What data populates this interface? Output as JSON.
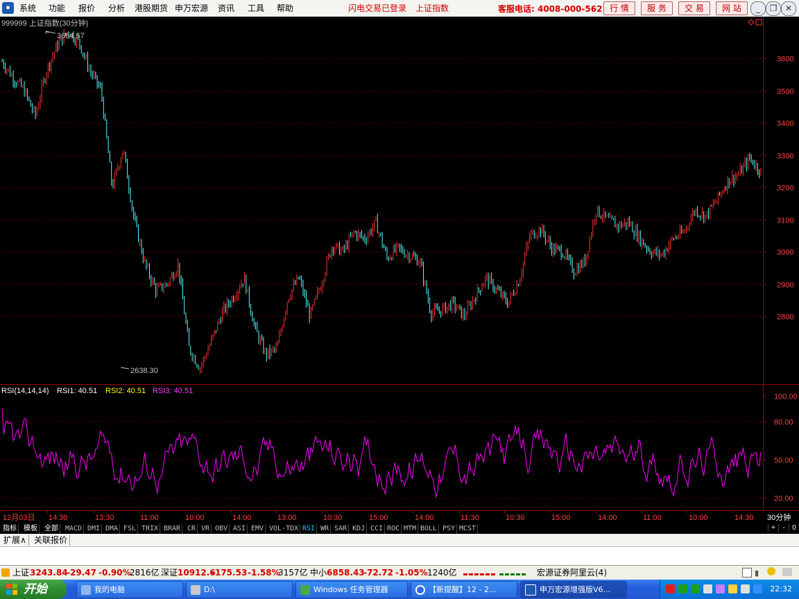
{
  "menu": {
    "items": [
      "系统",
      "功能",
      "报价",
      "分析",
      "港股期货",
      "申万宏源",
      "资讯",
      "工具",
      "帮助"
    ],
    "status1": "闪电交易已登录",
    "status2": "上证指数",
    "hotline": "客服电话: 4008-000-562",
    "nav": [
      "行 情",
      "服 务",
      "交 易",
      "网 站"
    ]
  },
  "chart": {
    "title": "999999 上证指数(30分钟)",
    "high_label": "3684.57",
    "low_label": "2638.30",
    "price_ticks": [
      "3600",
      "3500",
      "3400",
      "3300",
      "3200",
      "3100",
      "3000",
      "2900",
      "2800"
    ],
    "rsi_header": {
      "name": "RSI(14,14,14)",
      "rsi1": "RSI1: 40.51",
      "rsi2": "RSI2: 40.51",
      "rsi3": "RSI3: 40.51"
    },
    "rsi_ticks": [
      "100.00",
      "80.00",
      "50.00",
      "20.00"
    ],
    "time_labels": [
      "12月03日",
      "14:30",
      "13:30",
      "11:00",
      "10:00",
      "14:00",
      "13:00",
      "10:30",
      "15:00",
      "14:00",
      "11:30",
      "10:30",
      "15:00",
      "14:00",
      "11:00",
      "10:00",
      "14:30"
    ],
    "period": "30分钟",
    "colors": {
      "up": "#ff3030",
      "down": "#54ffff",
      "rsi": "#ff00ff",
      "grid": "#8b0000",
      "axis": "#a00000"
    }
  },
  "chart_data": {
    "type": "candlestick",
    "title": "999999 上证指数(30分钟)",
    "ylim": [
      2600,
      3700
    ],
    "close_path": [
      3590,
      3540,
      3500,
      3420,
      3560,
      3640,
      3684,
      3650,
      3560,
      3500,
      3200,
      3320,
      3100,
      2960,
      2880,
      2900,
      2960,
      2700,
      2640,
      2720,
      2810,
      2860,
      2920,
      2760,
      2680,
      2700,
      2860,
      2920,
      2800,
      2900,
      3020,
      3000,
      3060,
      3040,
      3090,
      2980,
      3010,
      2990,
      2970,
      2810,
      2820,
      2840,
      2800,
      2860,
      2920,
      2880,
      2840,
      2910,
      3050,
      3070,
      3010,
      3000,
      2940,
      2970,
      3130,
      3100,
      3080,
      3090,
      3040,
      3000,
      2990,
      3040,
      3060,
      3130,
      3110,
      3160,
      3220,
      3240,
      3290,
      3250
    ]
  },
  "indicator_tabs": [
    "指标",
    "模板",
    "全部",
    "MACD",
    "DMI",
    "DMA",
    "FSL",
    "TRIX",
    "BRAR",
    "CR",
    "VR",
    "OBV",
    "ASI",
    "EMV",
    "VOL-TDX",
    "RSI",
    "WR",
    "SAR",
    "KDJ",
    "CCI",
    "ROC",
    "MTM",
    "BOLL",
    "PSY",
    "MCST"
  ],
  "pager": [
    "+",
    "-",
    "0"
  ],
  "sub_tabs": [
    "扩展∧",
    "关联报价"
  ],
  "status": {
    "sh_name": "上证",
    "sh_value": "3243.84",
    "sh_chg": "-29.47",
    "sh_pct": "-0.90%",
    "sh_amt": "2816亿",
    "sz_name": "深证",
    "sz_value": "10912.6",
    "sz_chg": "-175.53",
    "sz_pct": "-1.58%",
    "sz_amt": "3157亿",
    "zx_name": "中小",
    "zx_value": "6858.43",
    "zx_chg": "-72.72",
    "zx_pct": "-1.05%",
    "zx_amt": "1240亿",
    "broker": "宏源证券阿里云(4)"
  },
  "taskbar": {
    "start": "开始",
    "tasks": [
      "我的电脑",
      "D:\\",
      "Windows 任务管理器",
      "【新提醒】12 - 2...",
      "申万宏源增强版V6..."
    ],
    "clock": "22:32"
  }
}
